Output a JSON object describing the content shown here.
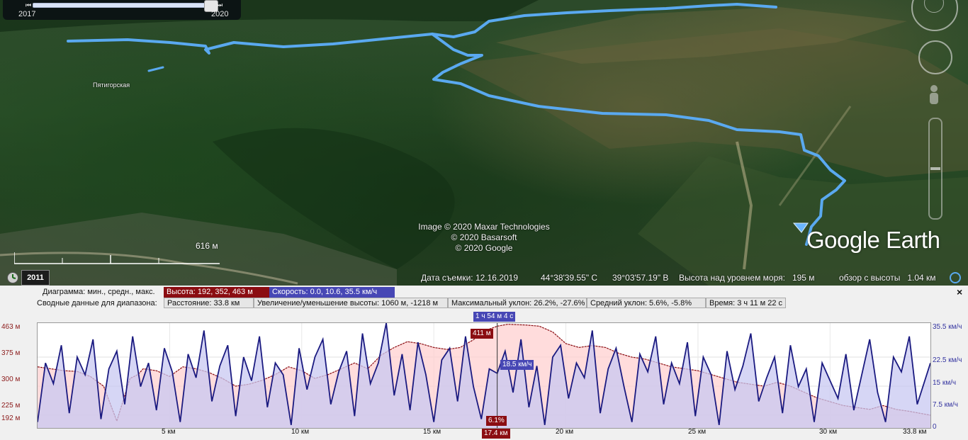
{
  "timeline": {
    "start_year": "2017",
    "end_year": "2020"
  },
  "map": {
    "place_label": "Пятигорская",
    "attribution": [
      "Image © 2020 Maxar Technologies",
      "© 2020 Basarsoft",
      "© 2020 Google"
    ],
    "logo_text": "Google Earth",
    "scale_label": "616 м",
    "imagery_year": "2011",
    "track_color": "#5aa9f0"
  },
  "status_bar": {
    "capture_date": "Дата съемки: 12.16.2019",
    "latitude": "44°38'39.55\" С",
    "longitude": "39°03'57.19\" В",
    "elevation": "Высота над уровнем моря:   195 м",
    "eye_alt": "обзор с высоты   1.04 км"
  },
  "profile": {
    "row1_label": "Диаграмма: мин., средн., макс.",
    "elev_stats": "Высота: 192, 352, 463 м",
    "speed_stats": "Скорость: 0.0, 10.6, 35.5 км/ч",
    "row2_label": "Сводные данные для диапазона:",
    "distance": "Расстояние: 33.8 км",
    "gain_loss": "Увеличение/уменьшение высоты: 1060 м, -1218 м",
    "max_slope": "Максимальный уклон: 26.2%, -27.6%",
    "avg_slope": "Средний уклон: 5.6%, -5.8%",
    "time": "Время: 3 ч 11 м 22 с",
    "cursor_time": "1 ч 54 м 4 с",
    "cursor_elev": "411 м",
    "cursor_speed": "18.5 км/ч",
    "cursor_slope": "6.1%",
    "cursor_dist": "17.4 км",
    "close_icon": "×"
  },
  "chart_data": {
    "type": "area",
    "x_unit": "км",
    "xlim": [
      0,
      33.8
    ],
    "x_ticks": [
      "5 км",
      "10 км",
      "15 км",
      "20 км",
      "25 км",
      "30 км",
      "33.8 км"
    ],
    "y_left_ticks": [
      "463 м",
      "375 м",
      "300 м",
      "225 м",
      "192 м"
    ],
    "y_left_lim": [
      192,
      463
    ],
    "y_right_ticks": [
      "35.5 км/ч",
      "22.5 км/ч",
      "15 км/ч",
      "7.5 км/ч",
      "0"
    ],
    "y_right_lim": [
      0,
      35.5
    ],
    "series": [
      {
        "name": "Высота",
        "color": "#8b0d12",
        "fill": "#ffd0d0",
        "x": [
          0,
          0.5,
          1,
          1.5,
          2,
          2.5,
          3,
          3.5,
          3.8,
          4,
          4.5,
          5,
          5.5,
          6,
          6.5,
          7,
          7.5,
          8,
          8.5,
          9,
          9.5,
          10,
          10.5,
          11,
          11.5,
          12,
          12.5,
          13,
          13.5,
          14,
          14.5,
          15,
          15.5,
          16,
          16.5,
          17,
          17.4,
          17.8,
          18.5,
          19,
          19.5,
          20,
          20.5,
          21,
          21.5,
          22,
          22.5,
          23,
          23.5,
          24,
          24.5,
          25,
          25.5,
          26,
          26.5,
          27,
          27.5,
          28,
          28.5,
          29,
          29.5,
          30,
          30.5,
          31,
          31.5,
          32,
          32.5,
          33,
          33.8
        ],
        "values": [
          350,
          345,
          340,
          338,
          325,
          300,
          210,
          320,
          330,
          345,
          340,
          325,
          350,
          345,
          335,
          320,
          300,
          305,
          315,
          330,
          350,
          340,
          320,
          330,
          345,
          360,
          345,
          380,
          400,
          415,
          410,
          400,
          395,
          400,
          420,
          445,
          455,
          460,
          458,
          455,
          440,
          410,
          400,
          405,
          400,
          385,
          375,
          370,
          360,
          350,
          345,
          340,
          330,
          320,
          310,
          305,
          300,
          310,
          300,
          285,
          270,
          260,
          250,
          245,
          240,
          250,
          240,
          235,
          225
        ]
      },
      {
        "name": "Скорость",
        "color": "#1a1a80",
        "fill": "#c8c8f2",
        "x": [
          0,
          0.3,
          0.6,
          0.9,
          1.2,
          1.5,
          1.8,
          2.1,
          2.4,
          2.7,
          3,
          3.3,
          3.6,
          3.9,
          4.2,
          4.5,
          4.8,
          5.1,
          5.4,
          5.7,
          6,
          6.3,
          6.6,
          6.9,
          7.2,
          7.5,
          7.8,
          8.1,
          8.4,
          8.7,
          9,
          9.3,
          9.6,
          9.9,
          10.2,
          10.5,
          10.8,
          11.1,
          11.4,
          11.7,
          12,
          12.3,
          12.6,
          12.9,
          13.2,
          13.5,
          13.8,
          14.1,
          14.4,
          14.7,
          15,
          15.3,
          15.6,
          15.9,
          16.2,
          16.5,
          16.8,
          17.1,
          17.4,
          17.7,
          18,
          18.3,
          18.6,
          18.9,
          19.2,
          19.5,
          19.8,
          20.1,
          20.4,
          20.7,
          21,
          21.3,
          21.6,
          21.9,
          22.2,
          22.5,
          22.8,
          23.1,
          23.4,
          23.7,
          24,
          24.3,
          24.6,
          24.9,
          25.2,
          25.5,
          25.8,
          26.1,
          26.4,
          26.7,
          27,
          27.3,
          27.6,
          27.9,
          28.2,
          28.5,
          28.8,
          29.1,
          29.4,
          29.7,
          30,
          30.3,
          30.6,
          30.9,
          31.2,
          31.5,
          31.8,
          32.1,
          32.4,
          32.7,
          33,
          33.3,
          33.8
        ],
        "values": [
          2,
          22,
          15,
          28,
          5,
          24,
          18,
          30,
          3,
          20,
          26,
          8,
          31,
          14,
          22,
          6,
          27,
          19,
          2,
          25,
          17,
          33,
          9,
          21,
          28,
          4,
          24,
          16,
          31,
          7,
          22,
          18,
          1,
          27,
          13,
          24,
          30,
          8,
          19,
          26,
          4,
          32,
          15,
          22,
          35.5,
          11,
          25,
          6,
          29,
          18,
          2,
          23,
          27,
          9,
          31,
          14,
          3,
          20,
          18.5,
          26,
          12,
          30,
          7,
          21,
          1,
          24,
          28,
          10,
          22,
          17,
          33,
          5,
          20,
          27,
          14,
          2,
          25,
          19,
          31,
          8,
          22,
          15,
          29,
          4,
          24,
          18,
          1,
          26,
          13,
          21,
          32,
          9,
          17,
          24,
          5,
          28,
          14,
          20,
          2,
          22,
          16,
          10,
          25,
          6,
          18,
          30,
          12,
          2,
          24,
          19,
          31,
          8,
          22
        ]
      }
    ],
    "cursor_x": 17.4
  }
}
